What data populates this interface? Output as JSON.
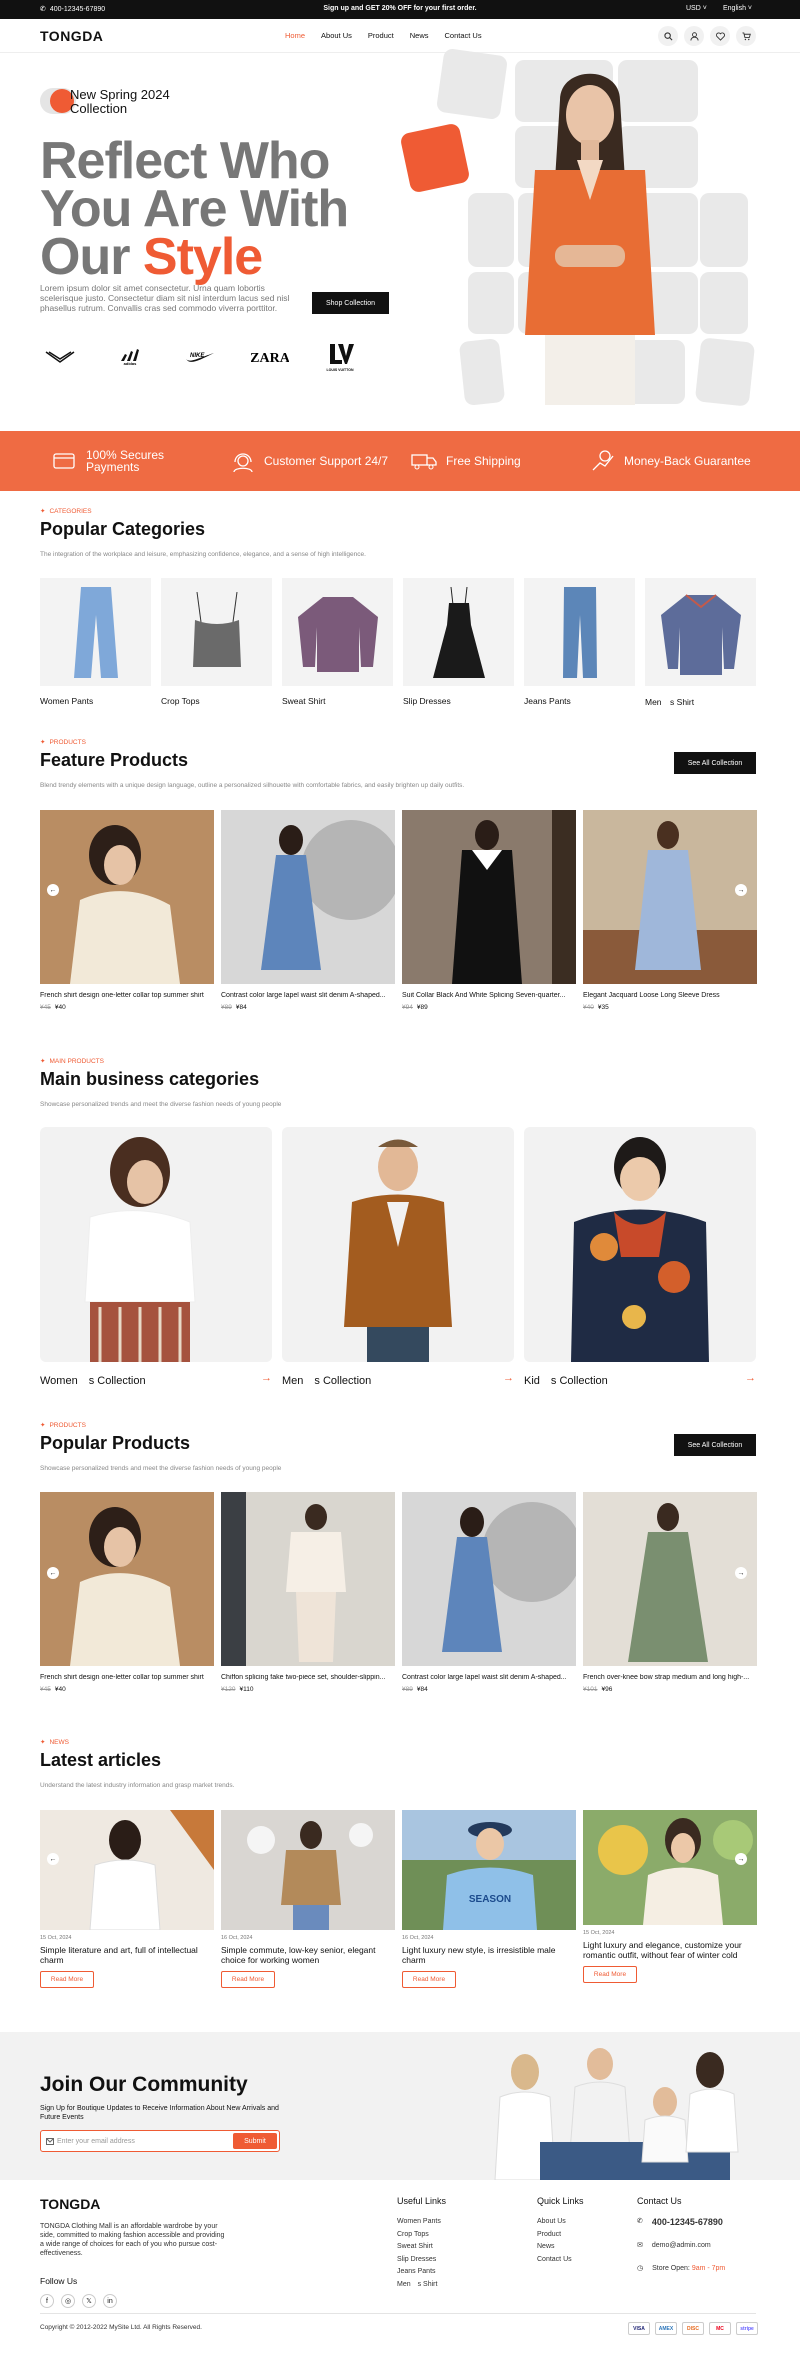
{
  "topbar": {
    "phone": "400-12345-67890",
    "promo": "Sign up and GET 20% OFF for your first order.",
    "currency": "USD",
    "language": "English"
  },
  "header": {
    "logo": "TONGDA",
    "nav": [
      "Home",
      "About Us",
      "Product",
      "News",
      "Contact Us"
    ],
    "active": "Home"
  },
  "hero": {
    "badge": "New Spring 2024 Collection",
    "title_line1": "Reflect Who",
    "title_line2": "You Are With",
    "title_line3_plain": "Our ",
    "title_line3_accent": "Style",
    "description": "Lorem ipsum dolor sit amet consectetur. Urna quam lobortis scelerisque justo. Consectetur diam sit nisl interdum lacus sed nisl phasellus rutrum. Convallis cras sed commodo viverra porttitor.",
    "button": "Shop Collection",
    "brands": [
      "GIORGIO ARMANI",
      "adidas",
      "Nike",
      "ZARA",
      "LOUIS VUITTON"
    ]
  },
  "services": [
    "100% Secures Payments",
    "Customer Support 24/7",
    "Free Shipping",
    "Money-Back Guarantee"
  ],
  "categories": {
    "eyebrow": "CATEGORIES",
    "title": "Popular Categories",
    "subtitle": "The integration of the workplace and leisure, emphasizing confidence, elegance, and a sense of high intelligence.",
    "items": [
      "Women Pants",
      "Crop Tops",
      "Sweat Shirt",
      "Slip Dresses",
      "Jeans Pants",
      "Men　s Shirt"
    ]
  },
  "feature": {
    "eyebrow": "PRODUCTS",
    "title": "Feature Products",
    "subtitle": "Blend trendy elements with a unique design language, outline a personalized silhouette with comfortable fabrics, and easily brighten up daily outfits.",
    "button": "See All Collection",
    "items": [
      {
        "name": "French shirt design one-letter collar top summer shirt",
        "old": "¥45",
        "price": "¥40"
      },
      {
        "name": "Contrast color large lapel waist slit denim A-shaped...",
        "old": "¥89",
        "price": "¥84"
      },
      {
        "name": "Suit Collar Black And White Splicing Seven-quarter...",
        "old": "¥94",
        "price": "¥89"
      },
      {
        "name": "Elegant Jacquard Loose Long Sleeve Dress",
        "old": "¥40",
        "price": "¥35"
      }
    ]
  },
  "main_cats": {
    "eyebrow": "MAIN PRODUCTS",
    "title": "Main business categories",
    "subtitle": "Showcase personalized trends and meet the diverse fashion needs of young people",
    "items": [
      "Women　s Collection",
      "Men　s Collection",
      "Kid　s Collection"
    ],
    "arrow": "→"
  },
  "popular": {
    "eyebrow": "PRODUCTS",
    "title": "Popular Products",
    "subtitle": "Showcase personalized trends and meet the diverse fashion needs of young people",
    "button": "See All Collection",
    "items": [
      {
        "name": "French shirt design one-letter collar top summer shirt",
        "old": "¥45",
        "price": "¥40"
      },
      {
        "name": "Chiffon splicing fake two-piece set, shoulder-slippin...",
        "old": "¥120",
        "price": "¥110"
      },
      {
        "name": "Contrast color large lapel waist slit denim A-shaped...",
        "old": "¥89",
        "price": "¥84"
      },
      {
        "name": "French over-knee bow strap medium and long high-...",
        "old": "¥101",
        "price": "¥96"
      }
    ]
  },
  "news": {
    "eyebrow": "NEWS",
    "title": "Latest articles",
    "subtitle": "Understand the latest industry information and grasp market trends.",
    "read_more": "Read More",
    "items": [
      {
        "date": "15 Oct, 2024",
        "title": "Simple literature and art, full of intellectual charm"
      },
      {
        "date": "16 Oct, 2024",
        "title": "Simple commute, low-key senior, elegant choice for working women"
      },
      {
        "date": "16 Oct, 2024",
        "title": "Light luxury new style, is irresistible male charm"
      },
      {
        "date": "15 Oct, 2024",
        "title": "Light luxury and elegance, customize your romantic outfit, without fear of winter cold"
      }
    ]
  },
  "community": {
    "title": "Join Our Community",
    "description": "Sign Up for Boutique Updates to Receive Information About New Arrivals and Future Events",
    "placeholder": "Enter your email address",
    "button": "Submit"
  },
  "footer": {
    "logo": "TONGDA",
    "about": "TONGDA Clothing Mall is an affordable wardrobe by your side, committed to making fashion accessible and providing a wide range of choices for each of you who pursue cost-effectiveness.",
    "follow": "Follow Us",
    "useful_title": "Useful Links",
    "useful": [
      "Women Pants",
      "Crop Tops",
      "Sweat Shirt",
      "Slip Dresses",
      "Jeans Pants",
      "Men　s Shirt"
    ],
    "quick_title": "Quick Links",
    "quick": [
      "About Us",
      "Product",
      "News",
      "Contact Us"
    ],
    "contact_title": "Contact Us",
    "phone": "400-12345-67890",
    "email": "demo@admin.com",
    "hours_label": "Store Open: ",
    "hours": "9am - 7pm",
    "copyright": "Copyright © 2012-2022 MySite Ltd. All Rights Reserved.",
    "payments": [
      "VISA",
      "AMEX",
      "DISC",
      "MC",
      "stripe"
    ]
  },
  "colors": {
    "accent": "#ef5b34",
    "dark": "#111111"
  }
}
